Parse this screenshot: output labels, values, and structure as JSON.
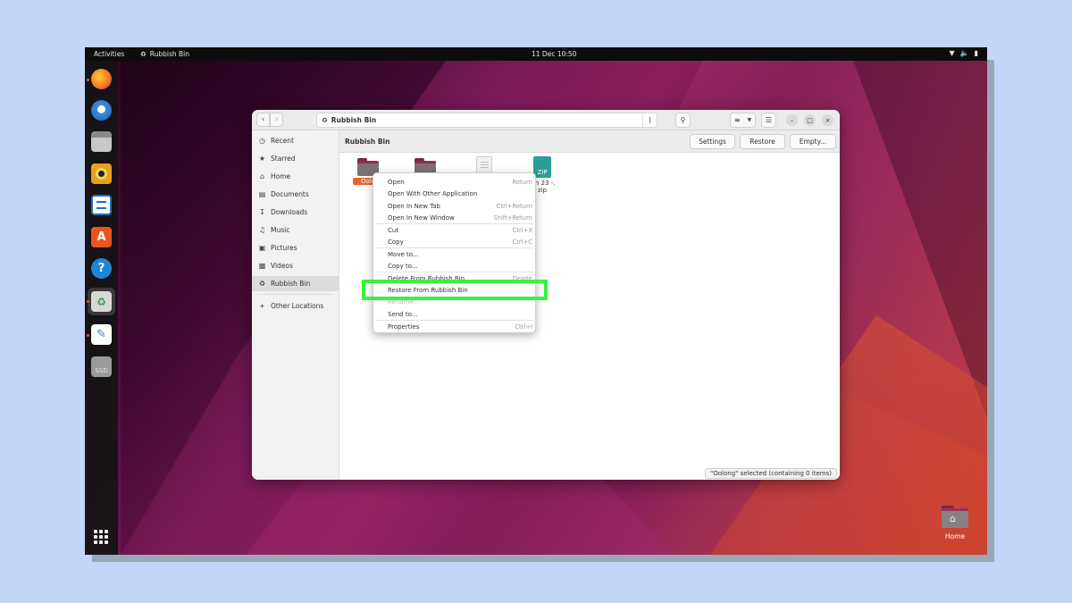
{
  "topbar": {
    "activities": "Activities",
    "app_name": "Rubbish Bin",
    "clock": "11 Dec  10:50"
  },
  "window": {
    "path_title": "Rubbish Bin",
    "content_title": "Rubbish Bin",
    "buttons": {
      "settings": "Settings",
      "restore": "Restore",
      "empty": "Empty..."
    },
    "status": "\"Oolong\" selected (containing 0 items)"
  },
  "sidebar": {
    "items": [
      {
        "label": "Recent",
        "icon": "clock-icon"
      },
      {
        "label": "Starred",
        "icon": "star-icon"
      },
      {
        "label": "Home",
        "icon": "home-icon"
      },
      {
        "label": "Documents",
        "icon": "document-icon"
      },
      {
        "label": "Downloads",
        "icon": "download-icon"
      },
      {
        "label": "Music",
        "icon": "music-icon"
      },
      {
        "label": "Pictures",
        "icon": "picture-icon"
      },
      {
        "label": "Videos",
        "icon": "video-icon"
      },
      {
        "label": "Rubbish Bin",
        "icon": "trash-icon"
      }
    ],
    "other": "Other Locations"
  },
  "files": [
    {
      "label": "Oolo",
      "type": "folder",
      "selected": true
    },
    {
      "label": "",
      "type": "folder"
    },
    {
      "label": "",
      "type": "document"
    },
    {
      "label": "Jan 23 -.",
      "label2": "zip",
      "type": "zip",
      "badge": "ZIP"
    }
  ],
  "context_menu": {
    "items": [
      {
        "label": "Open",
        "shortcut": "Return"
      },
      {
        "label": "Open With Other Application",
        "shortcut": ""
      },
      {
        "label": "Open In New Tab",
        "shortcut": "Ctrl+Return"
      },
      {
        "label": "Open In New Window",
        "shortcut": "Shift+Return"
      },
      {
        "label": "Cut",
        "shortcut": "Ctrl+X"
      },
      {
        "label": "Copy",
        "shortcut": "Ctrl+C"
      },
      {
        "label": "Move to...",
        "shortcut": ""
      },
      {
        "label": "Copy to...",
        "shortcut": ""
      },
      {
        "label": "Delete From Rubbish Bin",
        "shortcut": "Delete"
      },
      {
        "label": "Restore From Rubbish Bin",
        "shortcut": ""
      },
      {
        "label": "Rename...",
        "shortcut": ""
      },
      {
        "label": "Send to...",
        "shortcut": ""
      },
      {
        "label": "Properties",
        "shortcut": "Ctrl+I"
      }
    ]
  },
  "desktop": {
    "home_label": "Home"
  },
  "dock": {
    "ssd_label": "SSD"
  },
  "colors": {
    "accent": "#e95420",
    "highlight": "#3af23c",
    "selection": "#e8642c"
  }
}
